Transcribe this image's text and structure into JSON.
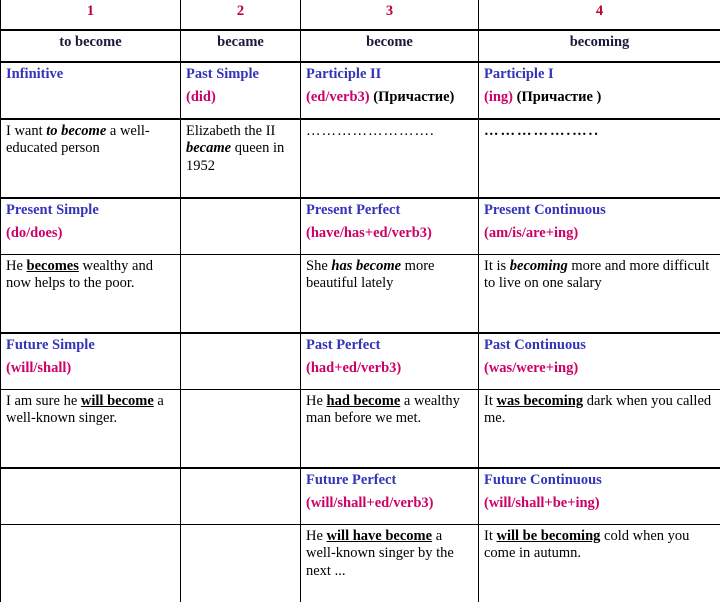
{
  "table": {
    "column_numbers": [
      "1",
      "2",
      "3",
      "4"
    ],
    "verb_forms": [
      "to become",
      "became",
      "become",
      "becoming"
    ],
    "form_headers": [
      {
        "name": "Infinitive",
        "formula": "",
        "ru": ""
      },
      {
        "name": "Past Simple",
        "formula": "(did)",
        "ru": ""
      },
      {
        "name": "Participle  II",
        "formula": "(ed/verb3)",
        "ru": "(Причастие)"
      },
      {
        "name": "Participle I",
        "formula": "(ing)",
        "ru": "(Причастие )"
      }
    ],
    "form_examples": [
      {
        "pre": "I want ",
        "em": "to become",
        "post": " a well-educated person"
      },
      {
        "pre": "Elizabeth the II ",
        "em": "became",
        "post": " queen in 1952"
      },
      {
        "dots": "……………………."
      },
      {
        "dots": "…………….…..",
        "bold": true
      }
    ],
    "tense_rows": [
      {
        "tenses": [
          {
            "name": "Present Simple",
            "formula": "(do/does)"
          },
          null,
          {
            "name": "Present Perfect",
            "formula": "(have/has+ed/verb3)"
          },
          {
            "name": "Present Continuous",
            "formula": "(am/is/are+ing)"
          }
        ],
        "examples": [
          {
            "pre": "He ",
            "u": "becomes",
            "post": " wealthy and now helps to the poor."
          },
          null,
          {
            "pre": "She ",
            "em": "has become",
            "post": " more beautiful lately"
          },
          {
            "pre": "It is ",
            "em": "becoming",
            "post": " more and more difficult  to live on one salary"
          }
        ]
      },
      {
        "tenses": [
          {
            "name": "Future Simple",
            "formula": "(will/shall)"
          },
          null,
          {
            "name": "Past Perfect",
            "formula": "(had+ed/verb3)"
          },
          {
            "name": "Past Continuous",
            "formula": "(was/were+ing)"
          }
        ],
        "examples": [
          {
            "pre": "I am sure he ",
            "u": "will become",
            "post": " a well-known singer."
          },
          null,
          {
            "pre": "He ",
            "u": "had become",
            "post": " a wealthy man before we met."
          },
          {
            "pre": "It ",
            "u": "was becoming",
            "post": " dark when you called me."
          }
        ]
      },
      {
        "tenses": [
          null,
          null,
          {
            "name": "Future Perfect",
            "formula": "(will/shall+ed/verb3)"
          },
          {
            "name": "Future Continuous",
            "formula": "(will/shall+be+ing)"
          }
        ],
        "examples": [
          null,
          null,
          {
            "pre": "He ",
            "u": "will have become",
            "post": " a well-known singer by the next ..."
          },
          {
            "pre": "It ",
            "u": "will be becoming",
            "post": " cold when you come in autumn."
          }
        ]
      }
    ]
  }
}
